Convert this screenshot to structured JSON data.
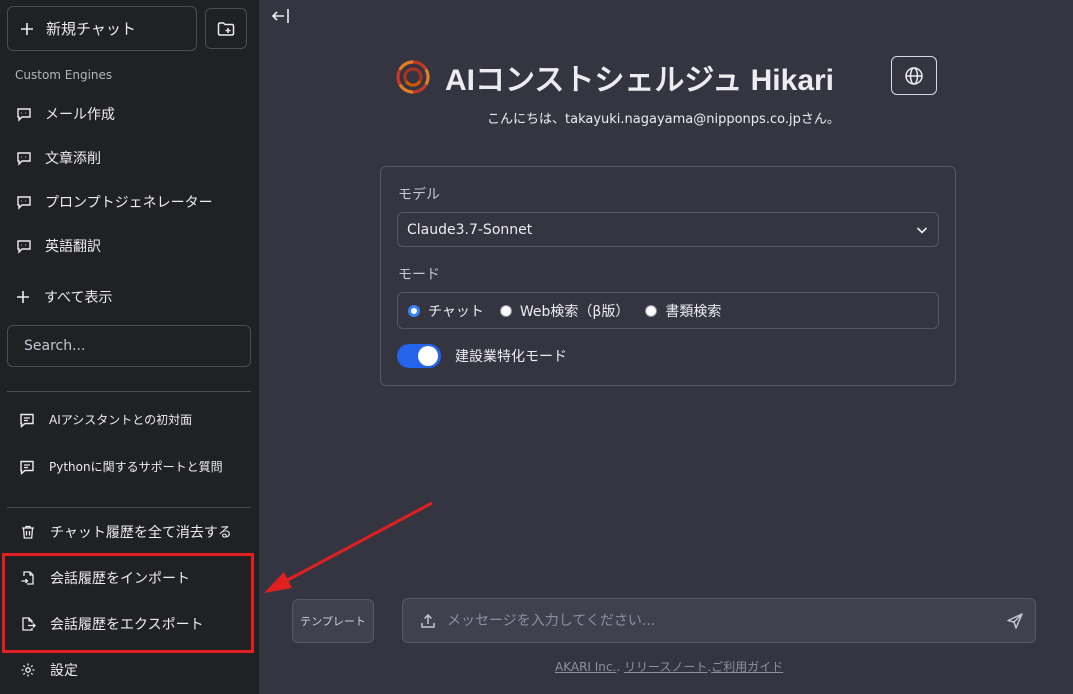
{
  "sidebar": {
    "new_chat_label": "新規チャット",
    "section_title": "Custom Engines",
    "engines": [
      {
        "label": "メール作成"
      },
      {
        "label": "文章添削"
      },
      {
        "label": "プロンプトジェネレーター"
      },
      {
        "label": "英語翻訳"
      }
    ],
    "show_all_label": "すべて表示",
    "search_placeholder": "Search...",
    "conversations": [
      {
        "label": "AIアシスタントとの初対面"
      },
      {
        "label": "Pythonに関するサポートと質問"
      }
    ],
    "bottom": {
      "clear_history": "チャット履歴を全て消去する",
      "import_history": "会話履歴をインポート",
      "export_history": "会話履歴をエクスポート",
      "settings": "設定"
    }
  },
  "header": {
    "title": "AIコンストシェルジュ Hikari",
    "greeting": "こんにちは、takayuki.nagayama@nipponps.co.jpさん。"
  },
  "settings": {
    "model_label": "モデル",
    "model_value": "Claude3.7-Sonnet",
    "mode_label": "モード",
    "modes": [
      {
        "label": "チャット",
        "checked": true
      },
      {
        "label": "Web検索（β版）",
        "checked": false
      },
      {
        "label": "書類検索",
        "checked": false
      }
    ],
    "toggle_label": "建設業特化モード",
    "toggle_on": true
  },
  "composer": {
    "template_label": "テンプレート",
    "message_placeholder": "メッセージを入力してください..."
  },
  "footer": {
    "company": "AKARI Inc.",
    "sep1": ". ",
    "release_notes": "リリースノート",
    "sep2": ".",
    "guide": "ご利用ガイド"
  },
  "colors": {
    "sidebar_bg": "#202123",
    "main_bg": "#343541",
    "accent": "#2563eb",
    "annotation_red": "#e02020"
  }
}
